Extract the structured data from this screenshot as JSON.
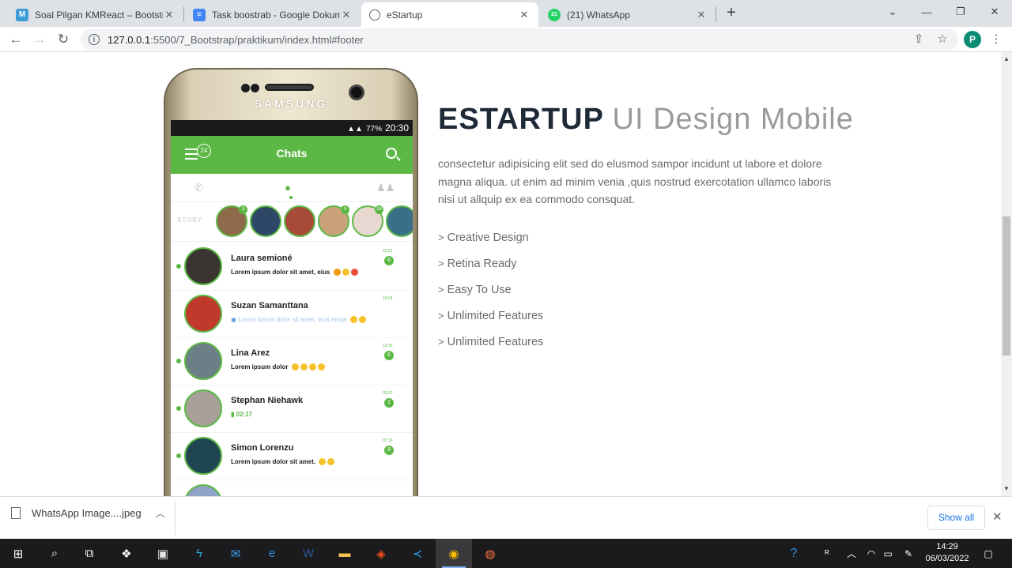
{
  "browser": {
    "tabs": [
      {
        "title": "Soal Pilgan KMReact – Bootstrap",
        "favicon": "M",
        "favicon_color": "#3d9bd6",
        "active": false
      },
      {
        "title": "Task boostrab - Google Dokumen",
        "favicon": "≡",
        "favicon_color": "#4285f4",
        "active": false
      },
      {
        "title": "eStartup",
        "favicon": "globe",
        "favicon_color": "#5f6368",
        "active": true
      },
      {
        "title": "(21) WhatsApp",
        "favicon": "21",
        "favicon_color": "#25d366",
        "active": false
      }
    ],
    "url_host": "127.0.0.1",
    "url_path": ":5500/7_Bootstrap/praktikum/index.html#footer",
    "profile_initial": "P"
  },
  "phone": {
    "brand": "SAMSUNG",
    "status_time": "20:30",
    "battery": "77%",
    "app_title": "Chats",
    "menu_badge": "24",
    "story_label": "STORY",
    "stories": [
      "3",
      "",
      "",
      "3",
      "18",
      ""
    ],
    "chats": [
      {
        "name": "Laura semioné",
        "message": "Lorem ipsum dolor sit amet, eius",
        "time": "10:21",
        "unread": "6",
        "emoji_count": 3,
        "style": "bold"
      },
      {
        "name": "Suzan Samanttana",
        "message": "Lorem ipsum dolor sit amet, eius eioqe",
        "time": "10:04",
        "unread": "",
        "emoji_count": 2,
        "style": "faded"
      },
      {
        "name": "Lina Arez",
        "message": "Lorem ipsum dolor",
        "time": "10:15",
        "unread": "6",
        "emoji_count": 4,
        "style": "bold"
      },
      {
        "name": "Stephan Niehawk",
        "message": "02:17",
        "time": "02:07",
        "unread": "1",
        "emoji_count": 0,
        "style": "green"
      },
      {
        "name": "Simon Lorenzu",
        "message": "Lorem ipsum dolor sit amet.",
        "time": "07:16",
        "unread": "8",
        "emoji_count": 2,
        "style": "bold"
      }
    ]
  },
  "content": {
    "heading_bold": "ESTARTUP",
    "heading_light": "UI Design Mobile",
    "description": "consectetur adipisicing elit sed do elusmod sampor incidunt ut labore et dolore magna aliqua. ut enim ad minim venia ,quis nostrud exercotation ullamco laboris nisi ut allquip ex ea commodo consquat.",
    "features": [
      "Creative Design",
      "Retina Ready",
      "Easy To Use",
      "Unlimited Features",
      "Unlimited Features"
    ]
  },
  "downloads": {
    "file_name": "WhatsApp Image....jpeg",
    "show_all": "Show all"
  },
  "taskbar": {
    "time": "14:29",
    "date": "06/03/2022"
  }
}
